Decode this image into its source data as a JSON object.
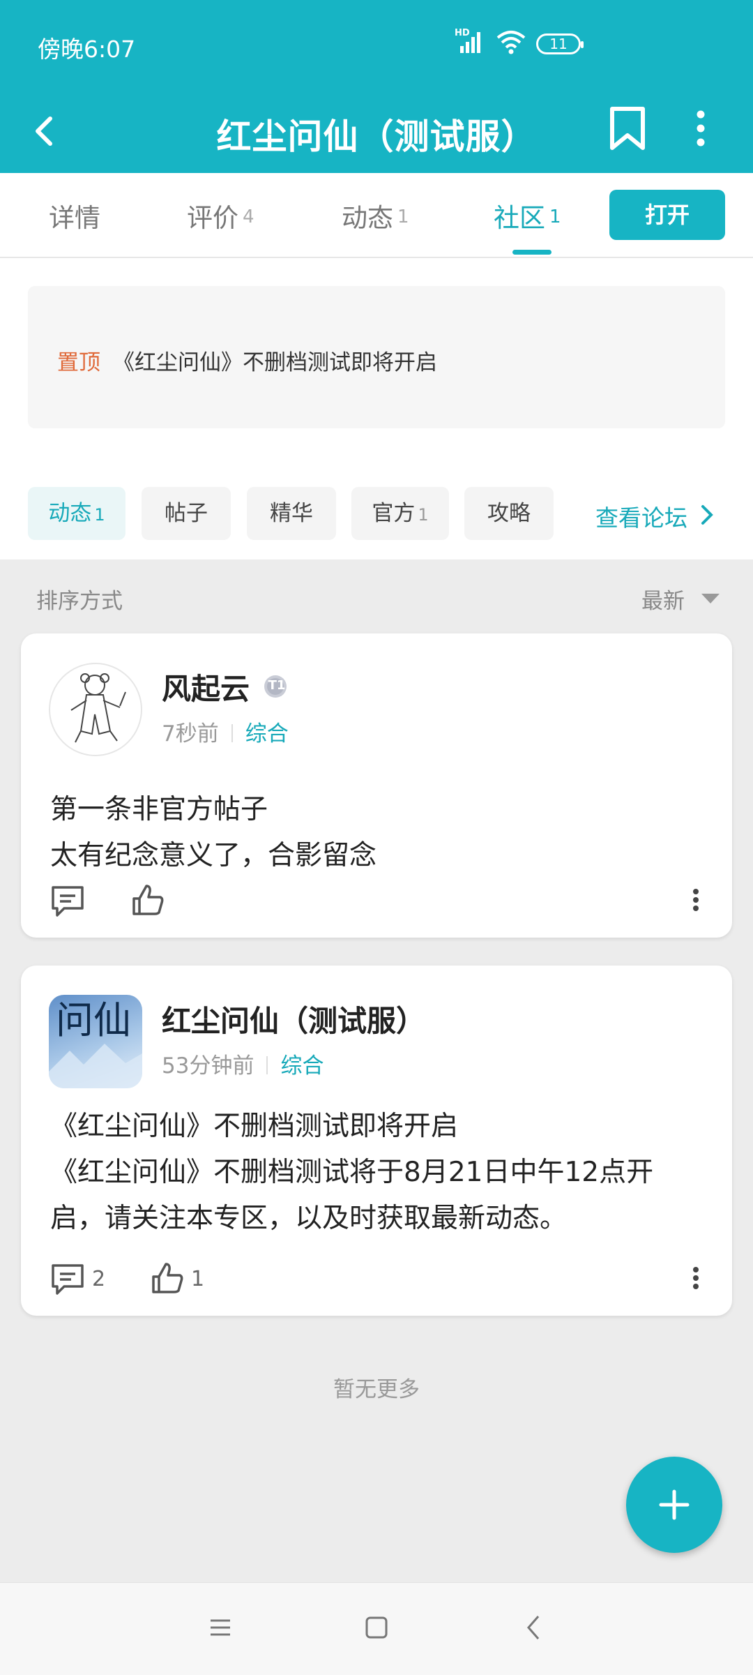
{
  "status_bar": {
    "time": "傍晚6:07",
    "signal_label": "HD",
    "battery_level": "11",
    "icons": [
      "hd-signal-icon",
      "wifi-icon",
      "battery-icon"
    ]
  },
  "header": {
    "title": "红尘问仙（测试服）",
    "icons": [
      "back-arrow-icon",
      "bookmark-icon",
      "more-vertical-icon"
    ]
  },
  "tabs": [
    {
      "label": "详情",
      "count": ""
    },
    {
      "label": "评价",
      "count": "4"
    },
    {
      "label": "动态",
      "count": "1"
    },
    {
      "label": "社区",
      "count": "1"
    }
  ],
  "active_tab": "社区",
  "open_button": "打开",
  "pinned": {
    "tag": "置顶",
    "text": "《红尘问仙》不删档测试即将开启"
  },
  "filters": [
    {
      "label": "动态",
      "count": "1"
    },
    {
      "label": "帖子",
      "count": ""
    },
    {
      "label": "精华",
      "count": ""
    },
    {
      "label": "官方",
      "count": "1"
    },
    {
      "label": "攻略",
      "count": ""
    }
  ],
  "forum_link": "查看论坛",
  "sort": {
    "label": "排序方式",
    "value": "最新"
  },
  "posts": [
    {
      "author": "风起云",
      "badge": "T1",
      "time": "7秒前",
      "category": "综合",
      "lines": [
        "第一条非官方帖子",
        "太有纪念意义了，合影留念"
      ],
      "comments": "",
      "likes": ""
    },
    {
      "author": "红尘问仙（测试服）",
      "avatar_text": "问仙",
      "time": "53分钟前",
      "category": "综合",
      "lines": [
        "《红尘问仙》不删档测试即将开启",
        "《红尘问仙》不删档测试将于8月21日中午12点开",
        "启，请关注本专区，以及时获取最新动态。"
      ],
      "comments": "2",
      "likes": "1"
    }
  ],
  "footer_text": "暂无更多",
  "colors": {
    "accent": "#17b4c4",
    "pinned_tag": "#e06a3a",
    "background": "#ececec"
  },
  "nav_icons": [
    "menu-icon",
    "home-square-icon",
    "back-chevron-icon"
  ]
}
